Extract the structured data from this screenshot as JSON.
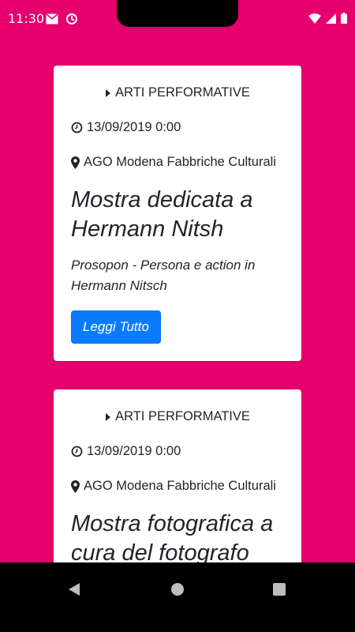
{
  "status_bar": {
    "time": "11:30",
    "icons_left": [
      "mail-icon",
      "sync-icon"
    ],
    "icons_right": [
      "wifi-icon",
      "signal-icon",
      "battery-icon"
    ]
  },
  "colors": {
    "background": "#e5006e",
    "card": "#ffffff",
    "button": "#0a7bfe",
    "text": "#212529"
  },
  "events": [
    {
      "category": "ARTI PERFORMATIVE",
      "datetime": "13/09/2019 0:00",
      "location": "AGO Modena Fabbriche Culturali",
      "title": "Mostra dedicata a Hermann Nitsh",
      "subtitle": "Prosopon - Persona e action in Hermann Nitsch",
      "button_label": "Leggi Tutto"
    },
    {
      "category": "ARTI PERFORMATIVE",
      "datetime": "13/09/2019 0:00",
      "location": "AGO Modena Fabbriche Culturali",
      "title": "Mostra fotografica a cura del fotografo"
    }
  ],
  "nav_bar": {
    "buttons": [
      "back-icon",
      "home-icon",
      "recents-icon"
    ]
  }
}
